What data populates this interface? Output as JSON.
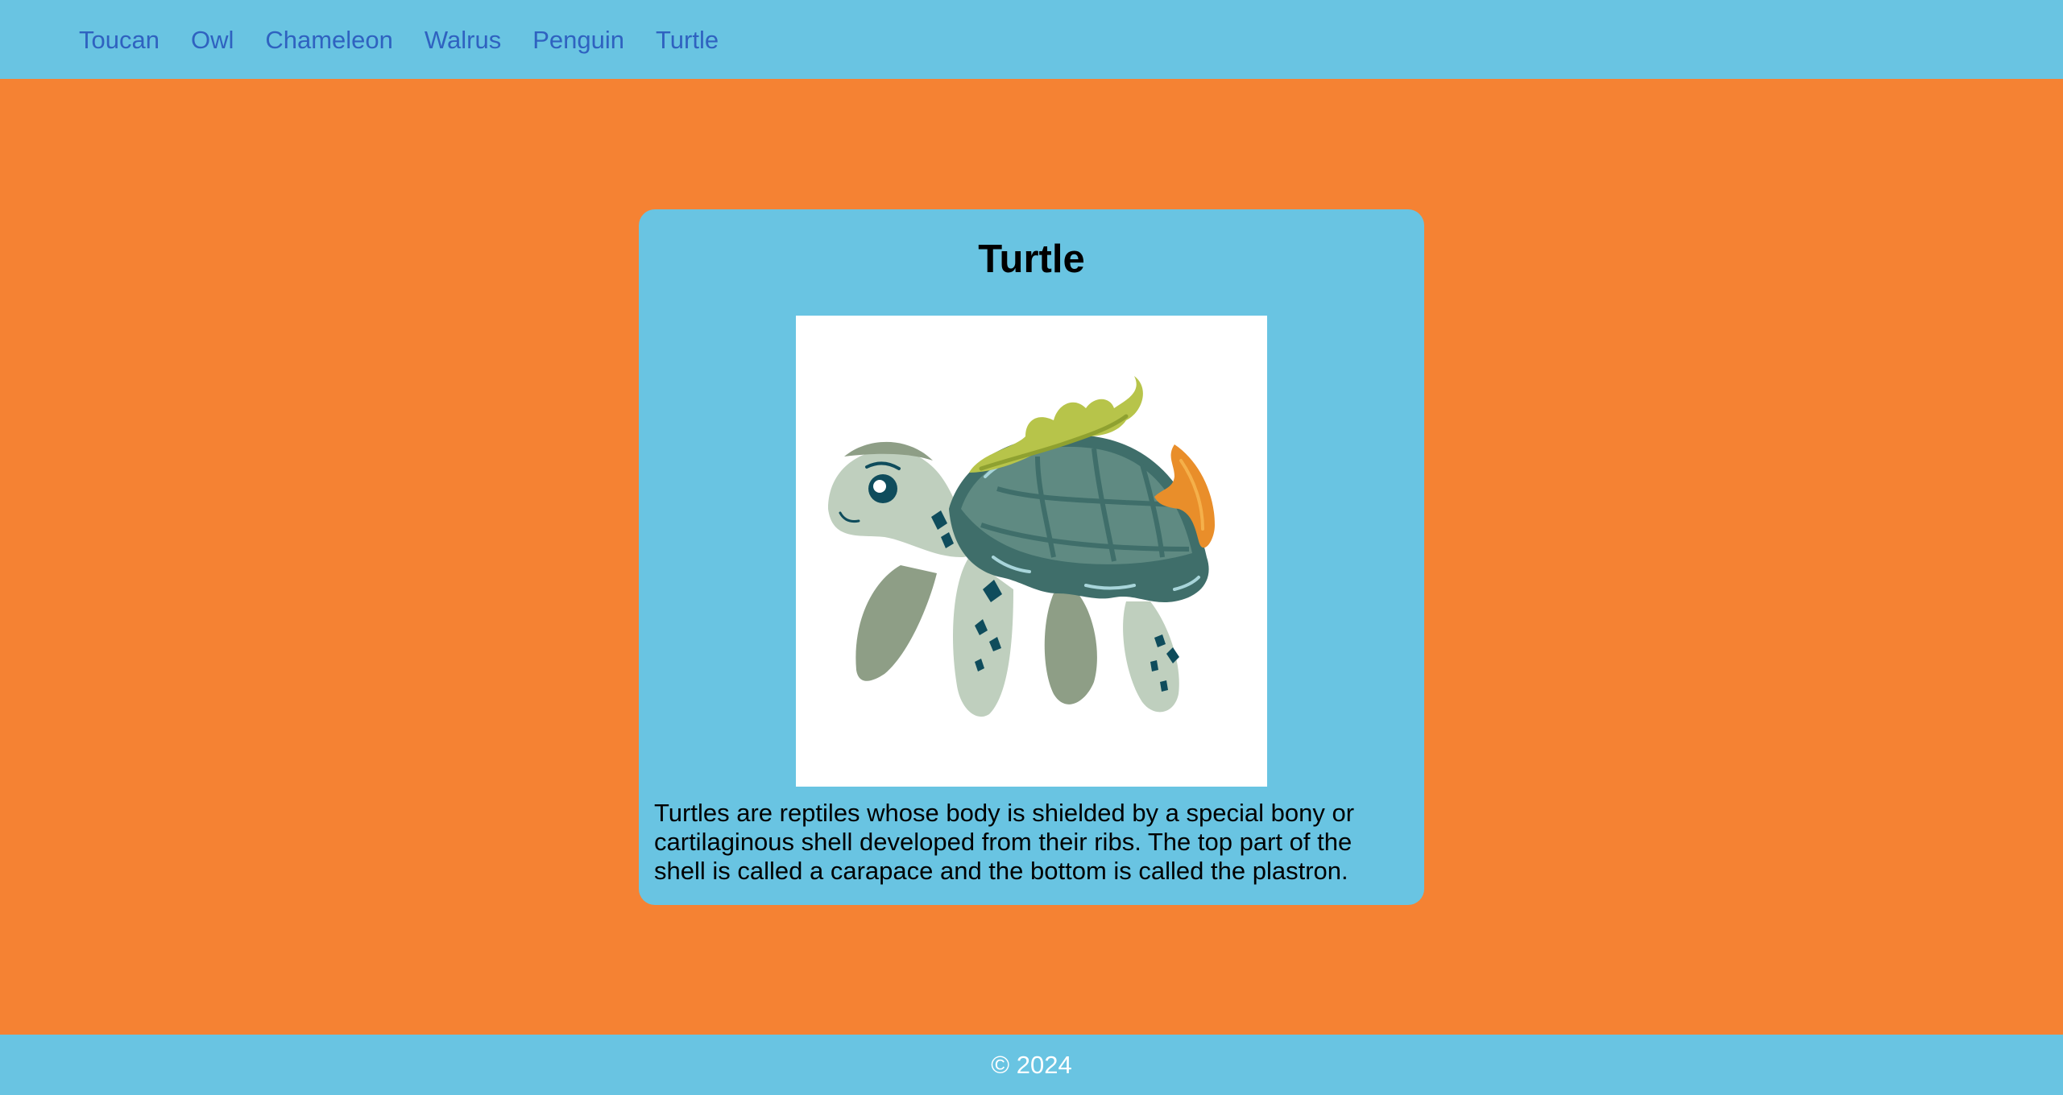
{
  "nav": {
    "items": [
      {
        "label": "Toucan"
      },
      {
        "label": "Owl"
      },
      {
        "label": "Chameleon"
      },
      {
        "label": "Walrus"
      },
      {
        "label": "Penguin"
      },
      {
        "label": "Turtle"
      }
    ]
  },
  "card": {
    "title": "Turtle",
    "image_icon": "sea-turtle-illustration",
    "description": "Turtles are reptiles whose body is shielded by a special bony or cartilaginous shell developed from their ribs. The top part of the shell is called a carapace and the bottom is called the plastron."
  },
  "footer": {
    "copyright": "© 2024"
  },
  "colors": {
    "page_background": "#F58233",
    "nav_background": "#69C4E2",
    "nav_link": "#2F62C0",
    "card_background": "#69C4E2",
    "footer_text": "#FFFFFF"
  }
}
